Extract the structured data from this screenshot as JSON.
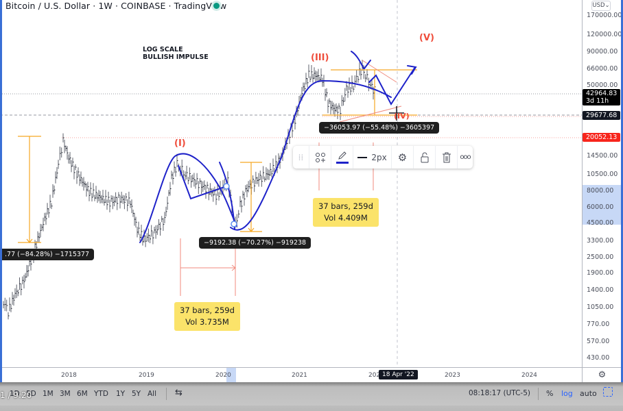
{
  "header": {
    "title": "Bitcoin / U.S. Dollar · 1W · COINBASE · TradingView",
    "status": "market-open"
  },
  "annotations": {
    "note_line1": "LOG SCALE",
    "note_line2": "BULLISH IMPULSE",
    "wave_labels": [
      "(I)",
      "(III)",
      "(IV)",
      "(V)"
    ],
    "measure_tips": [
      ".77 (−84.28%) −1715377",
      "−9192.38 (−70.27%) −919238",
      "−36053.97 (−55.48%) −3605397"
    ],
    "stats_boxes": [
      {
        "line1": "37 bars, 259d",
        "line2": "Vol 3.735M"
      },
      {
        "line1": "37 bars, 259d",
        "line2": "Vol 4.409M"
      }
    ]
  },
  "toolbar": {
    "items": [
      {
        "icon": "drag-handle-icon"
      },
      {
        "icon": "template-add-icon"
      },
      {
        "icon": "pencil-color-icon",
        "color": "#1e22c9"
      },
      {
        "icon": "line-width-icon",
        "label": "2px"
      },
      {
        "icon": "gear-icon"
      },
      {
        "icon": "unlock-icon"
      },
      {
        "icon": "trash-icon"
      },
      {
        "icon": "more-icon",
        "label": "ooo"
      }
    ]
  },
  "price_axis": {
    "currency": "USD",
    "labels": [
      "170000.00",
      "120000.00",
      "90000.00",
      "66000.00",
      "50000.00",
      "14500.00",
      "10500.00",
      "8000.00",
      "6000.00",
      "4500.00",
      "3300.00",
      "2500.00",
      "1900.00",
      "1400.00",
      "1050.00",
      "770.00",
      "570.00",
      "430.00"
    ],
    "current_price": "42964.83",
    "countdown": "3d 11h",
    "crosshair_price": "29677.68",
    "line_price": "20052.13"
  },
  "time_axis": {
    "labels": [
      "2018",
      "2019",
      "2020",
      "2021",
      "202",
      "2023",
      "2024"
    ],
    "crosshair_date": "18 Apr '22"
  },
  "bottom_bar": {
    "video_time": "1 / 9:20",
    "ranges": [
      "1D",
      "5D",
      "1M",
      "3M",
      "6M",
      "YTD",
      "1Y",
      "5Y",
      "All"
    ],
    "clock": "08:18:17 (UTC-5)",
    "percent": "%",
    "log": "log",
    "auto": "auto"
  },
  "colors": {
    "wave_label": "#ef4c3a",
    "drawing_blue": "#1e22c9",
    "fib_orange": "#f5a623",
    "price_red": "#f7251c",
    "log_active": "#2962ff"
  }
}
